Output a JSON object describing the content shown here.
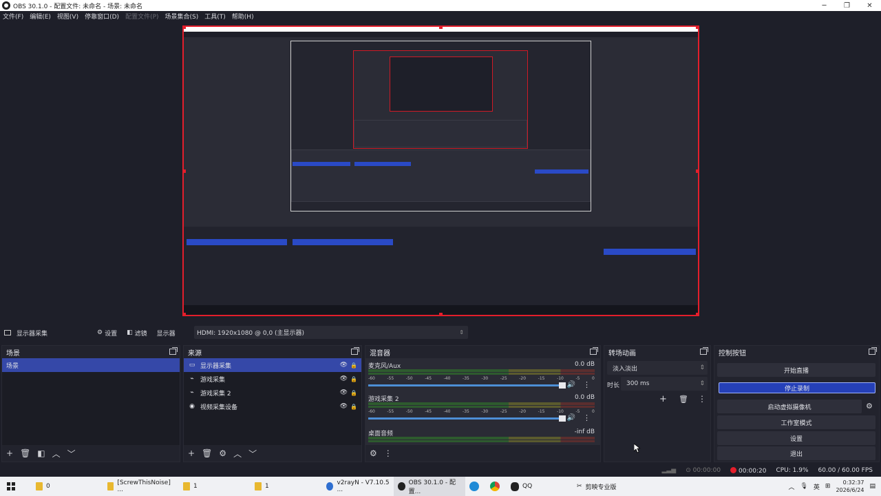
{
  "window": {
    "title": "OBS 30.1.0 - 配置文件: 未命名 - 场景: 未命名"
  },
  "menu": [
    "文件(F)",
    "编辑(E)",
    "视图(V)",
    "停靠窗口(D)",
    "配置文件(P)",
    "场景集合(S)",
    "工具(T)",
    "帮助(H)"
  ],
  "menu_disabled_index": 4,
  "source_bar": {
    "source_name": "显示器采集",
    "properties": "设置",
    "filters": "滤镜",
    "display_label": "显示器",
    "display_value": "HDMI: 1920x1080 @ 0,0 (主显示器)"
  },
  "scenes": {
    "title": "场景",
    "items": [
      "场景"
    ]
  },
  "sources": {
    "title": "来源",
    "items": [
      {
        "label": "显示器采集",
        "icon": "monitor-icon"
      },
      {
        "label": "游戏采集",
        "icon": "gamepad-icon"
      },
      {
        "label": "游戏采集 2",
        "icon": "gamepad-icon"
      },
      {
        "label": "视频采集设备",
        "icon": "camera-icon"
      }
    ]
  },
  "mixer": {
    "title": "混音器",
    "channels": [
      {
        "name": "麦克风/Aux",
        "db": "0.0 dB"
      },
      {
        "name": "游戏采集 2",
        "db": "0.0 dB"
      },
      {
        "name": "桌面音频",
        "db": "-inf dB"
      }
    ],
    "scale": [
      "-60",
      "-55",
      "-50",
      "-45",
      "-40",
      "-35",
      "-30",
      "-25",
      "-20",
      "-15",
      "-10",
      "-5",
      "0"
    ]
  },
  "transitions": {
    "title": "转场动画",
    "type": "淡入淡出",
    "duration_label": "时长",
    "duration": "300 ms"
  },
  "controls": {
    "title": "控制按钮",
    "buttons": [
      "开始直播",
      "停止录制",
      "启动虚拟摄像机",
      "工作室模式",
      "设置",
      "退出"
    ]
  },
  "status": {
    "stream_time": "00:00:00",
    "rec_time": "00:00:20",
    "cpu": "CPU: 1.9%",
    "fps": "60.00 / 60.00 FPS"
  },
  "taskbar": {
    "items": [
      "0",
      "[ScrewThisNoise] ...",
      "1",
      "1",
      "v2rayN - V7.10.5 ...",
      "OBS 30.1.0 - 配置...",
      "QQ",
      "剪映专业版"
    ],
    "ime": "英",
    "time": "0:32:37",
    "date": "2026/6/24"
  }
}
